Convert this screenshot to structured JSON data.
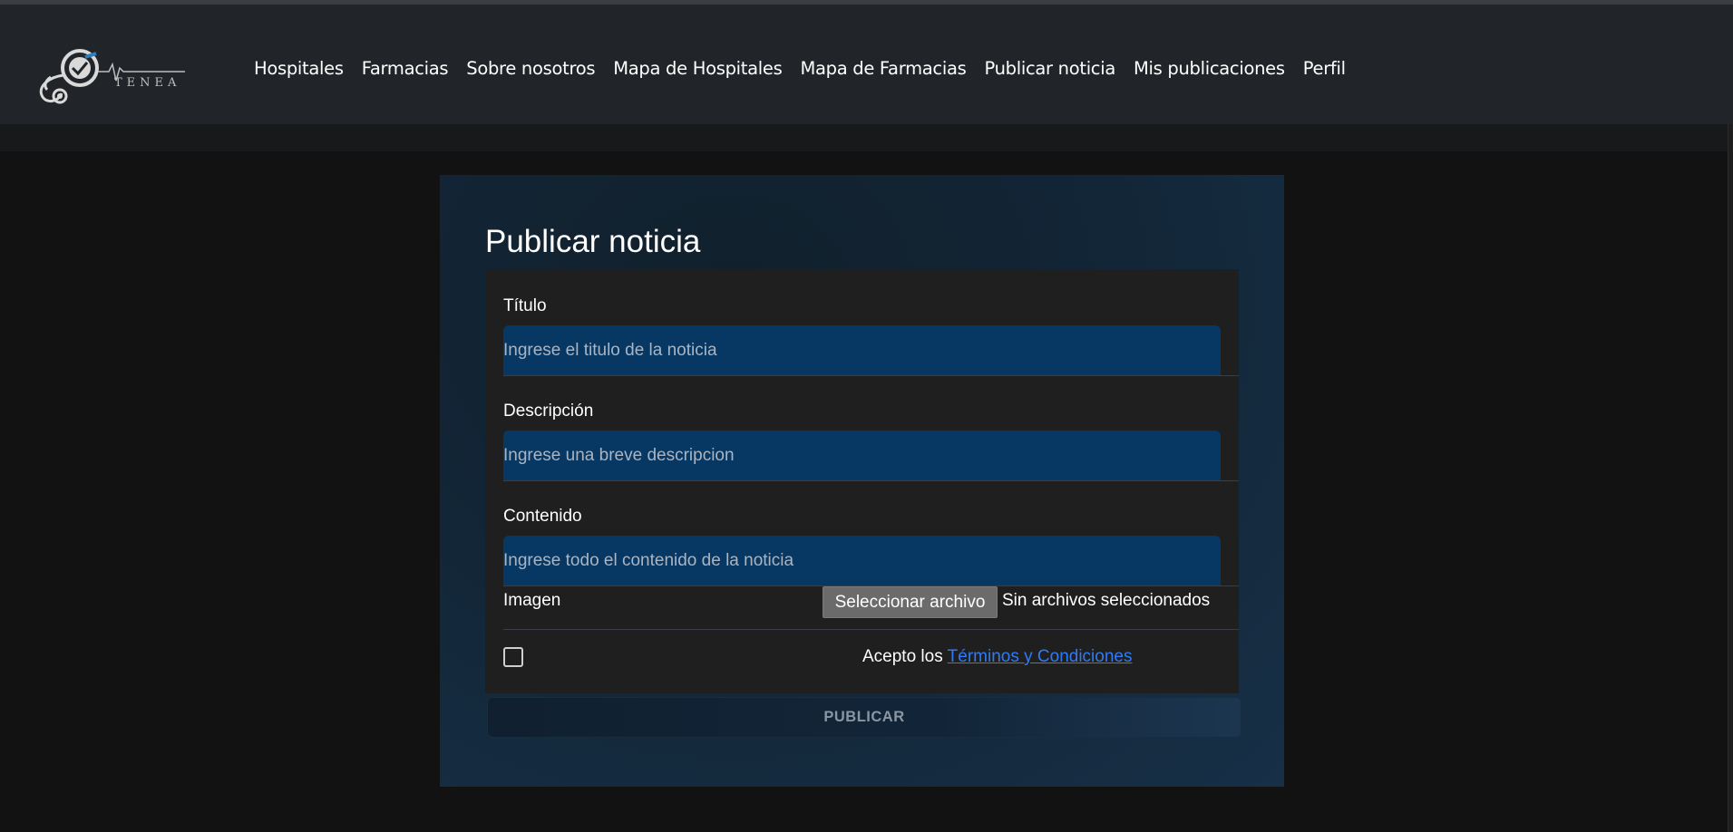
{
  "brand": {
    "logo_text": "TENEA"
  },
  "nav": {
    "items": [
      {
        "label": "Hospitales"
      },
      {
        "label": "Farmacias"
      },
      {
        "label": "Sobre nosotros"
      },
      {
        "label": "Mapa de Hospitales"
      },
      {
        "label": "Mapa de Farmacias"
      },
      {
        "label": "Publicar noticia"
      },
      {
        "label": "Mis publicaciones"
      },
      {
        "label": "Perfil"
      }
    ]
  },
  "form": {
    "title": "Publicar noticia",
    "titulo": {
      "label": "Título",
      "placeholder": "Ingrese el titulo de la noticia",
      "value": ""
    },
    "descripcion": {
      "label": "Descripción",
      "placeholder": "Ingrese una breve descripcion",
      "value": ""
    },
    "contenido": {
      "label": "Contenido",
      "placeholder": "Ingrese todo el contenido de la noticia",
      "value": ""
    },
    "imagen": {
      "label": "Imagen",
      "button_label": "Seleccionar archivo",
      "status": "Sin archivos seleccionados"
    },
    "terms": {
      "prefix": "Acepto los",
      "link": "Términos y Condiciones",
      "checked": false
    },
    "submit_label": "PUBLICAR"
  },
  "colors": {
    "navbar_bg": "#212428",
    "page_bg": "#121212",
    "input_bg": "#073763",
    "link": "#2f7bf6"
  }
}
